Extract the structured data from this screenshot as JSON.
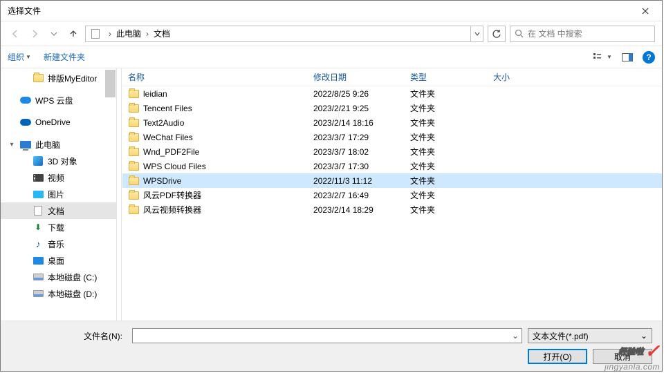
{
  "title": "选择文件",
  "path": {
    "root": "此电脑",
    "folder": "文档"
  },
  "search": {
    "placeholder": "在 文档 中搜索"
  },
  "toolbar": {
    "organize": "组织",
    "newfolder": "新建文件夹"
  },
  "columns": {
    "name": "名称",
    "date": "修改日期",
    "type": "类型",
    "size": "大小"
  },
  "tree": [
    {
      "icon": "folder",
      "label": "排版MyEditor",
      "indent": "sub"
    },
    {
      "icon": "wps",
      "label": "WPS 云盘",
      "indent": "",
      "gapBefore": true
    },
    {
      "icon": "od",
      "label": "OneDrive",
      "indent": "",
      "gapBefore": true
    },
    {
      "icon": "pc",
      "label": "此电脑",
      "indent": "",
      "exp": "▾",
      "gapBefore": true
    },
    {
      "icon": "obj",
      "label": "3D 对象",
      "indent": "sub"
    },
    {
      "icon": "vid",
      "label": "视频",
      "indent": "sub"
    },
    {
      "icon": "img",
      "label": "图片",
      "indent": "sub"
    },
    {
      "icon": "doc",
      "label": "文档",
      "indent": "sub",
      "sel": true
    },
    {
      "icon": "dl",
      "label": "下载",
      "indent": "sub"
    },
    {
      "icon": "music",
      "label": "音乐",
      "indent": "sub"
    },
    {
      "icon": "desk",
      "label": "桌面",
      "indent": "sub"
    },
    {
      "icon": "disk",
      "label": "本地磁盘 (C:)",
      "indent": "sub"
    },
    {
      "icon": "disk",
      "label": "本地磁盘 (D:)",
      "indent": "sub"
    }
  ],
  "files": [
    {
      "name": "leidian",
      "date": "2022/8/25 9:26",
      "type": "文件夹"
    },
    {
      "name": "Tencent Files",
      "date": "2023/2/21 9:25",
      "type": "文件夹"
    },
    {
      "name": "Text2Audio",
      "date": "2023/2/14 18:16",
      "type": "文件夹"
    },
    {
      "name": "WeChat Files",
      "date": "2023/3/7 17:29",
      "type": "文件夹"
    },
    {
      "name": "Wnd_PDF2File",
      "date": "2023/3/7 18:02",
      "type": "文件夹"
    },
    {
      "name": "WPS Cloud Files",
      "date": "2023/3/7 17:30",
      "type": "文件夹"
    },
    {
      "name": "WPSDrive",
      "date": "2022/11/3 11:12",
      "type": "文件夹",
      "sel": true
    },
    {
      "name": "风云PDF转换器",
      "date": "2023/2/7 16:49",
      "type": "文件夹"
    },
    {
      "name": "风云视频转换器",
      "date": "2023/2/14 18:29",
      "type": "文件夹"
    }
  ],
  "footer": {
    "fname_label": "文件名(N):",
    "filter": "文本文件(*.pdf)",
    "open": "打开(O)",
    "cancel": "取消"
  },
  "watermark": {
    "line1": "经验啦",
    "line2": "jingyanla.com"
  }
}
